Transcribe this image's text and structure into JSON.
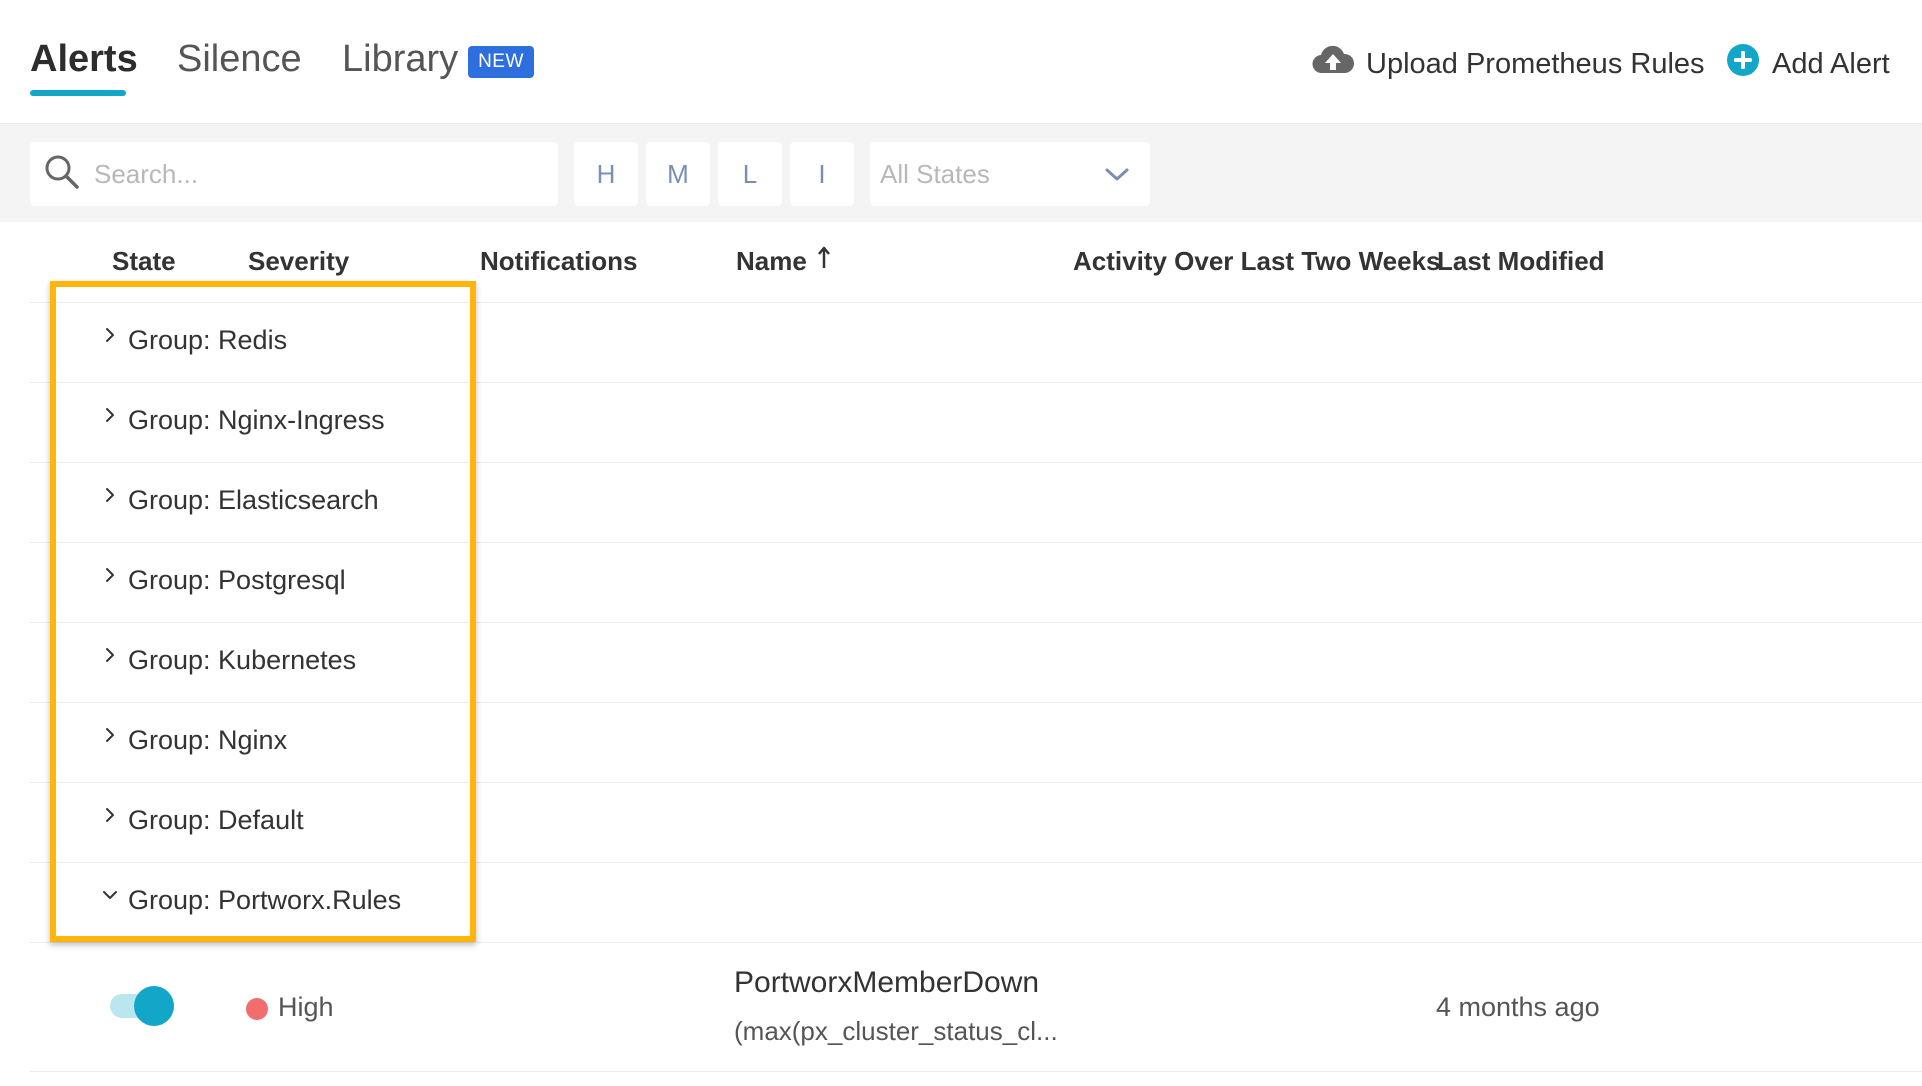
{
  "tabs": [
    {
      "label": "Alerts",
      "active": true
    },
    {
      "label": "Silence",
      "active": false
    },
    {
      "label": "Library",
      "active": false,
      "badge": "NEW"
    }
  ],
  "actions": {
    "upload_label": "Upload Prometheus Rules",
    "upload_icon": "cloud-upload-icon",
    "add_label": "Add Alert",
    "add_icon": "plus-circle-icon"
  },
  "filters": {
    "search_placeholder": "Search...",
    "severity_buttons": [
      "H",
      "M",
      "L",
      "I"
    ],
    "state_selected": "All States"
  },
  "table": {
    "columns": {
      "state": "State",
      "severity": "Severity",
      "notifications": "Notifications",
      "name": "Name",
      "activity": "Activity Over Last Two Weeks",
      "last_modified": "Last Modified"
    },
    "sort": {
      "column": "Name",
      "direction": "ascending"
    },
    "groups": [
      {
        "label": "Group: Redis",
        "expanded": false
      },
      {
        "label": "Group: Nginx-Ingress",
        "expanded": false
      },
      {
        "label": "Group: Elasticsearch",
        "expanded": false
      },
      {
        "label": "Group: Postgresql",
        "expanded": false
      },
      {
        "label": "Group: Kubernetes",
        "expanded": false
      },
      {
        "label": "Group: Nginx",
        "expanded": false
      },
      {
        "label": "Group: Default",
        "expanded": false
      },
      {
        "label": "Group: Portworx.Rules",
        "expanded": true
      }
    ],
    "alerts": [
      {
        "enabled": true,
        "severity": "High",
        "name": "PortworxMemberDown",
        "expression": "(max(px_cluster_status_cl...",
        "last_modified": "4 months ago"
      }
    ]
  },
  "colors": {
    "accent": "#12a7c9",
    "badge": "#2e6fe0",
    "highlight": "#ffb50a",
    "severity_high": "#f26d6d"
  }
}
